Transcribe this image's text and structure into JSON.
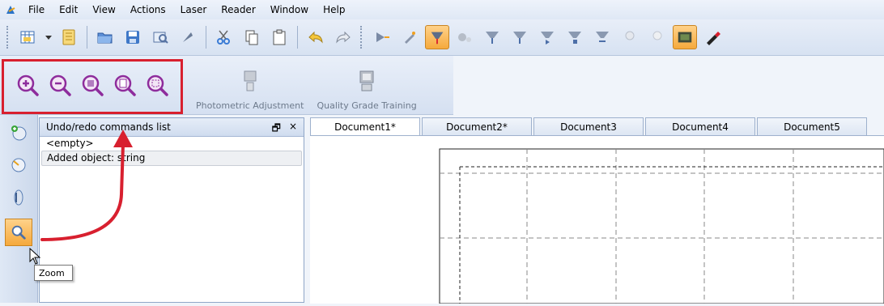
{
  "menu": {
    "items": [
      "File",
      "Edit",
      "View",
      "Actions",
      "Laser",
      "Reader",
      "Window",
      "Help"
    ]
  },
  "toolbar2": {
    "zoom_buttons": [
      "zoom-in-icon",
      "zoom-out-icon",
      "zoom-selection-icon",
      "zoom-fit-icon",
      "zoom-area-icon"
    ],
    "photometric_label": "Photometric Adjustment",
    "quality_label": "Quality Grade Training"
  },
  "panel": {
    "title": "Undo/redo commands list",
    "items": [
      "<empty>",
      "Added object: string"
    ],
    "pin_glyph": "🗗",
    "close_glyph": "×"
  },
  "tabs": [
    "Document1*",
    "Document2*",
    "Document3",
    "Document4",
    "Document5"
  ],
  "tooltip": {
    "text": "Zoom"
  },
  "colors": {
    "highlight": "#d8202f",
    "active_tool": "#f5a93c"
  }
}
